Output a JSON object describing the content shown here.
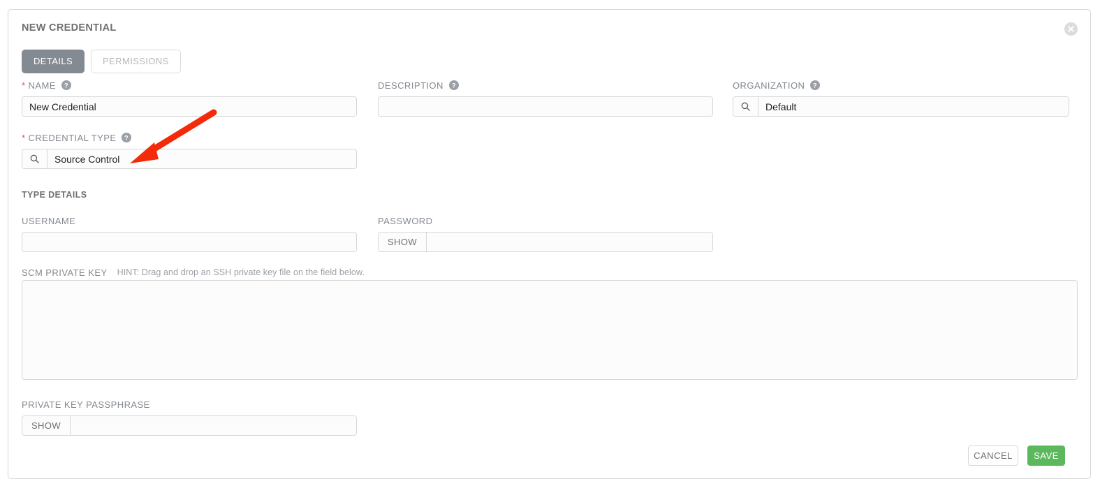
{
  "panel": {
    "title": "NEW CREDENTIAL",
    "close_icon": "close-circle-icon"
  },
  "tabs": [
    {
      "label": "DETAILS",
      "active": true
    },
    {
      "label": "PERMISSIONS",
      "active": false
    }
  ],
  "fields": {
    "name": {
      "label": "NAME",
      "required_marker": "*",
      "value": "New Credential",
      "placeholder": "",
      "help_icon": "help-circle-icon"
    },
    "description": {
      "label": "DESCRIPTION",
      "value": "",
      "placeholder": "",
      "help_icon": "help-circle-icon"
    },
    "organization": {
      "label": "ORGANIZATION",
      "value": "Default",
      "placeholder": "",
      "help_icon": "help-circle-icon",
      "lookup_icon": "search-icon"
    },
    "credential_type": {
      "label": "CREDENTIAL TYPE",
      "required_marker": "*",
      "value": "Source Control",
      "placeholder": "",
      "help_icon": "help-circle-icon",
      "lookup_icon": "search-icon"
    },
    "username": {
      "label": "USERNAME",
      "value": "",
      "placeholder": ""
    },
    "password": {
      "label": "PASSWORD",
      "value": "",
      "placeholder": "",
      "show_button": "SHOW"
    },
    "scm_private_key": {
      "label": "SCM PRIVATE KEY",
      "hint": "HINT: Drag and drop an SSH private key file on the field below.",
      "value": "",
      "placeholder": ""
    },
    "private_key_passphrase": {
      "label": "PRIVATE KEY PASSPHRASE",
      "value": "",
      "placeholder": "",
      "show_button": "SHOW"
    }
  },
  "sections": {
    "type_details": "TYPE DETAILS"
  },
  "footer": {
    "cancel_label": "CANCEL",
    "save_label": "SAVE"
  },
  "annotation": {
    "type": "arrow",
    "color": "#f42b0a",
    "points_to": "credential-type-input"
  },
  "colors": {
    "tab_active_bg": "#848a91",
    "save_green": "#5cb85c",
    "required_red": "#d9534f",
    "label_gray": "#848a91",
    "border_gray": "#d7d7d7",
    "annotation_red": "#f42b0a"
  }
}
